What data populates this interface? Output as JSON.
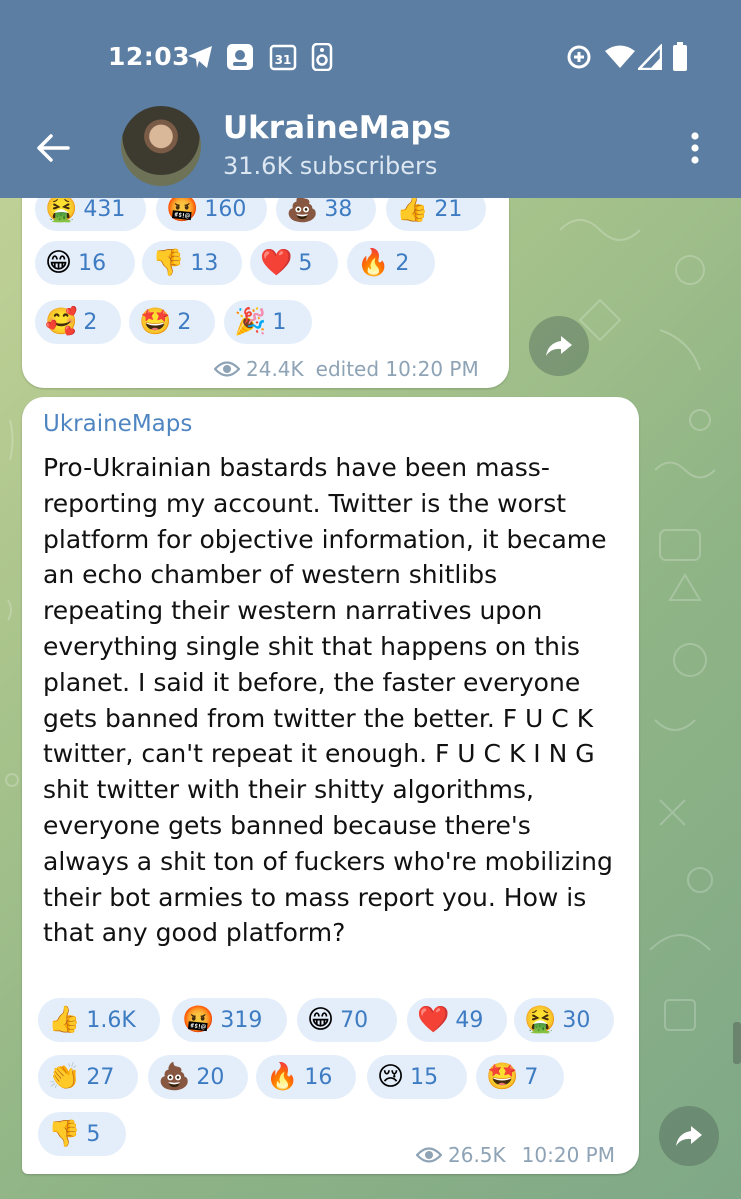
{
  "status_bar": {
    "time": "12:03",
    "icons": [
      "telegram-icon",
      "photo-icon",
      "calendar-icon",
      "speaker-icon",
      "data-saver-icon",
      "wifi-icon",
      "signal-icon",
      "battery-icon"
    ],
    "calendar_day": "31"
  },
  "header": {
    "title": "UkraineMaps",
    "subtitle": "31.6K subscribers",
    "background": "#5c7ea3"
  },
  "messages": [
    {
      "reactions": [
        {
          "emoji": "🤮",
          "count": "431"
        },
        {
          "emoji": "🤬",
          "count": "160"
        },
        {
          "emoji": "💩",
          "count": "38"
        },
        {
          "emoji": "👍",
          "count": "21"
        },
        {
          "emoji": "😁",
          "count": "16"
        },
        {
          "emoji": "👎",
          "count": "13"
        },
        {
          "emoji": "❤️",
          "count": "5"
        },
        {
          "emoji": "🔥",
          "count": "2"
        },
        {
          "emoji": "🥰",
          "count": "2"
        },
        {
          "emoji": "🤩",
          "count": "2"
        },
        {
          "emoji": "🎉",
          "count": "1"
        }
      ],
      "views": "24.4K",
      "time": "edited 10:20 PM"
    },
    {
      "sender": "UkraineMaps",
      "text": "Pro-Ukrainian bastards have been mass-reporting my account. Twitter is the worst platform for objective information, it became an echo chamber of western shitlibs repeating their western narratives upon everything single shit that happens on this planet. I said it before, the faster everyone gets banned from twitter the better. F U C K twitter, can't repeat it enough. F U C K I N G shit twitter with their shitty algorithms, everyone gets banned because there's always a shit ton of fuckers who're mobilizing their bot armies to mass report you. How is that any good platform?",
      "reactions": [
        {
          "emoji": "👍",
          "count": "1.6K"
        },
        {
          "emoji": "🤬",
          "count": "319"
        },
        {
          "emoji": "😁",
          "count": "70"
        },
        {
          "emoji": "❤️",
          "count": "49"
        },
        {
          "emoji": "🤮",
          "count": "30"
        },
        {
          "emoji": "👏",
          "count": "27"
        },
        {
          "emoji": "💩",
          "count": "20"
        },
        {
          "emoji": "🔥",
          "count": "16"
        },
        {
          "emoji": "😢",
          "count": "15"
        },
        {
          "emoji": "🤩",
          "count": "7"
        },
        {
          "emoji": "👎",
          "count": "5"
        }
      ],
      "views": "26.5K",
      "time": "10:20 PM"
    }
  ],
  "colors": {
    "accent": "#4f86c2",
    "reaction_bg": "#e4eefa",
    "reaction_count": "#3d7bc2",
    "meta": "#8ea3b5"
  }
}
